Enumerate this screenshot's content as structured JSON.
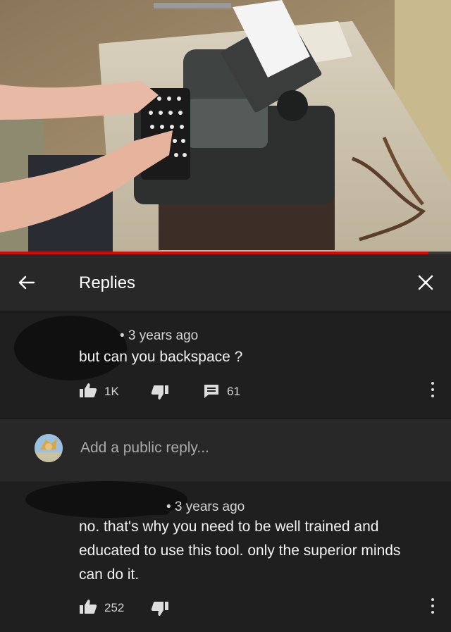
{
  "video": {
    "progress_fraction": 0.95
  },
  "header": {
    "title": "Replies"
  },
  "comment1": {
    "meta": "• 3 years ago",
    "text": "but can you backspace ?",
    "likes": "1K",
    "replies": "61"
  },
  "reply_bar": {
    "placeholder": "Add a public reply..."
  },
  "comment2": {
    "meta": "• 3 years ago",
    "text_line1": "no. that's why you need to be well trained and",
    "text_line2": "educated to use this tool. only the superior minds",
    "text_line3": "can do it.",
    "likes": "252"
  },
  "colors": {
    "background": "#1f1f1f",
    "header": "#282828",
    "progress": "#ee0000"
  },
  "icons": [
    "back-arrow-icon",
    "close-icon",
    "thumbs-up-icon",
    "thumbs-down-icon",
    "reply-icon",
    "more-vertical-icon"
  ]
}
